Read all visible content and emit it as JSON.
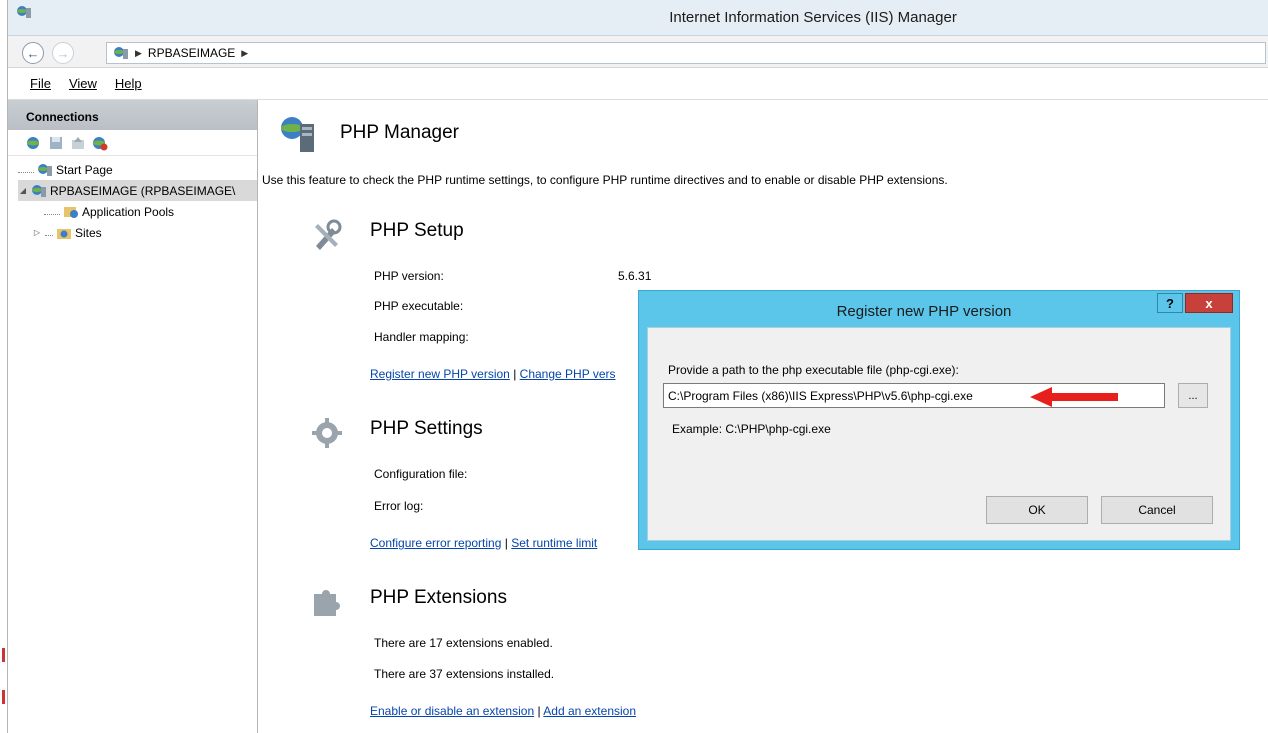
{
  "window": {
    "title": "Internet Information Services (IIS) Manager",
    "app_icon": "iis-manager-icon"
  },
  "address_bar": {
    "back_icon": "back-arrow-icon",
    "forward_icon": "forward-arrow-icon",
    "breadcrumb": [
      "RPBASEIMAGE"
    ]
  },
  "menu": {
    "items": [
      "File",
      "View",
      "Help"
    ]
  },
  "connections": {
    "header": "Connections",
    "toolbar_icons": [
      "connect-icon",
      "save-icon",
      "up-icon",
      "disconnect-icon"
    ],
    "tree": [
      {
        "label": "Start Page",
        "icon": "start-page-icon"
      },
      {
        "label": "RPBASEIMAGE (RPBASEIMAGE\\",
        "icon": "server-icon"
      },
      {
        "label": "Application Pools",
        "icon": "app-pools-icon"
      },
      {
        "label": "Sites",
        "icon": "sites-folder-icon"
      }
    ]
  },
  "main": {
    "title": "PHP Manager",
    "description": "Use this feature to check the PHP runtime settings, to configure PHP runtime directives and to enable or disable PHP extensions.",
    "setup": {
      "title": "PHP Setup",
      "version_label": "PHP version:",
      "version_value": "5.6.31",
      "executable_label": "PHP executable:",
      "handler_label": "Handler mapping:",
      "link1": "Register new PHP version",
      "separator": "|",
      "link2": "Change PHP vers"
    },
    "settings": {
      "title": "PHP Settings",
      "config_label": "Configuration file:",
      "errorlog_label": "Error log:",
      "link1": "Configure error reporting",
      "link2": "Set runtime limit"
    },
    "extensions": {
      "title": "PHP Extensions",
      "enabled_text": "There are 17 extensions enabled.",
      "installed_text": "There are 37 extensions installed.",
      "link1": "Enable or disable an extension",
      "link2": "Add an extension"
    }
  },
  "dialog": {
    "title": "Register new PHP version",
    "help_label": "?",
    "close_label": "x",
    "prompt": "Provide a path to the php executable file (php-cgi.exe):",
    "path_value": "C:\\Program Files (x86)\\IIS Express\\PHP\\v5.6\\php-cgi.exe",
    "browse_label": "...",
    "example": "Example: C:\\PHP\\php-cgi.exe",
    "ok_label": "OK",
    "cancel_label": "Cancel"
  },
  "colors": {
    "dialog_frame": "#5bc6ea",
    "close_button": "#c7403a",
    "link": "#0645ad",
    "annotation_arrow": "#e8201c"
  }
}
